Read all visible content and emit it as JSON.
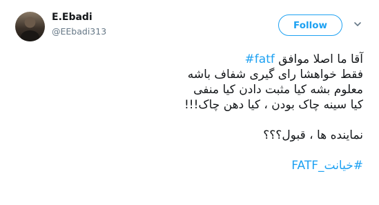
{
  "author": {
    "name": "E.Ebadi",
    "handle": "@EEbadi313"
  },
  "follow_label": "Follow",
  "icons": {
    "avatar": "user-avatar",
    "menu": "chevron-down-icon"
  },
  "colors": {
    "accent": "#1da1f2",
    "text": "#14171a",
    "secondary": "#657786"
  },
  "tweet": {
    "line1_text": "آقا ما اصلا موافق ",
    "line1_hashtag": "#fatf",
    "line2": "فقط خواهشا رای گیری شفاف باشه",
    "line3": "معلوم بشه کیا مثبت دادن کیا منفی",
    "line4": "کیا سینه چاک بودن  ، کیا دهن چاک!!!",
    "line5": "نماینده ها ، قبول؟؟؟",
    "hashtag2": "#خیانت_FATF"
  }
}
